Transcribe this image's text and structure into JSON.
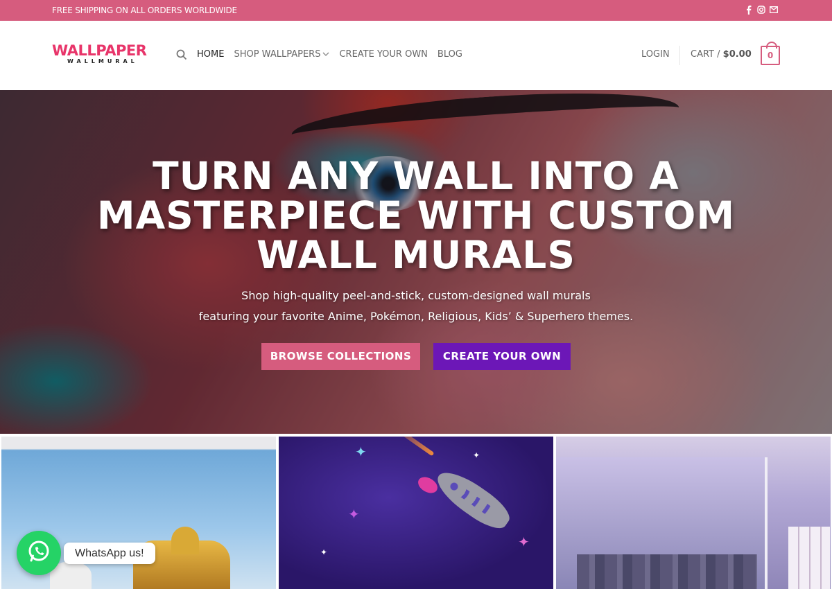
{
  "topbar": {
    "promo": "FREE SHIPPING ON ALL ORDERS WORLDWIDE",
    "socials": [
      "facebook-icon",
      "instagram-icon",
      "envelope-icon"
    ]
  },
  "header": {
    "logo_main": "WALLPAPER",
    "logo_sub": "WALLMURAL",
    "nav": {
      "home": "HOME",
      "shop": "SHOP WALLPAPERS",
      "create": "CREATE YOUR OWN",
      "blog": "BLOG"
    },
    "login": "LOGIN",
    "cart_label": "CART /",
    "cart_total": "$0.00",
    "cart_count": "0"
  },
  "hero": {
    "title_line1": "TURN ANY WALL INTO A",
    "title_line2": "MASTERPIECE WITH CUSTOM",
    "title_line3": "WALL MURALS",
    "subtitle_line1": "Shop high-quality peel-and-stick, custom-designed wall murals",
    "subtitle_line2": "featuring your favorite Anime, Pokémon, Religious, Kids’ & Superhero themes.",
    "browse_button": "BROWSE COLLECTIONS",
    "create_button": "CREATE YOUR OWN"
  },
  "colors": {
    "brand_pink": "#d65c7e",
    "brand_purple": "#6c17b7",
    "whatsapp_green": "#25d366"
  },
  "whatsapp": {
    "label": "WhatsApp us!"
  }
}
